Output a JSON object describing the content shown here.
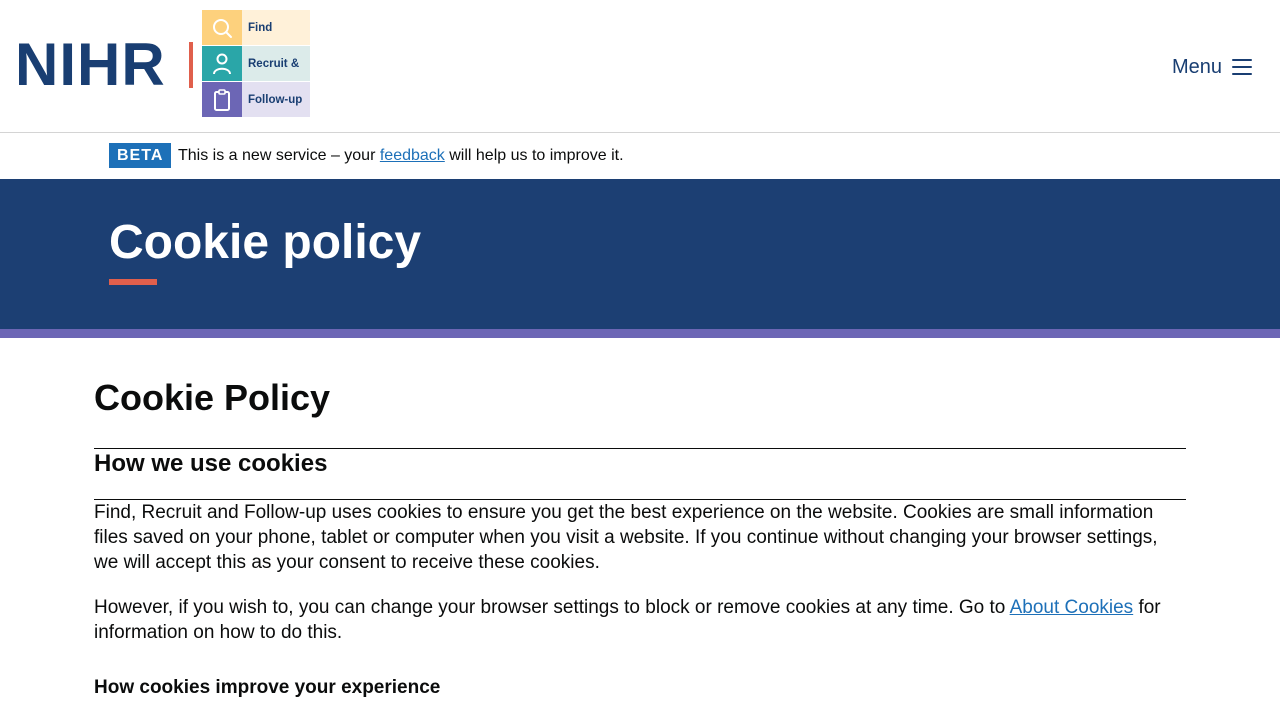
{
  "header": {
    "logo": {
      "org": "NIHR",
      "tiles": [
        "Find",
        "Recruit &",
        "Follow-up"
      ]
    },
    "menu_label": "Menu"
  },
  "beta_banner": {
    "tag": "BETA",
    "text_before": "This is a new service – your ",
    "link_text": "feedback",
    "text_after": " will help us to improve it."
  },
  "hero": {
    "title": "Cookie policy"
  },
  "main": {
    "heading": "Cookie Policy",
    "section_heading": "How we use cookies",
    "paragraph_1": "Find, Recruit and Follow-up uses cookies to ensure you get the best experience on the website. Cookies are small information files saved on your phone, tablet or computer when you visit a website.  If you continue without changing your browser settings, we will accept this as your consent to receive these cookies.",
    "paragraph_2_before": "However, if you wish to, you can change your browser settings to block or remove cookies at any time. Go to ",
    "paragraph_2_link": "About Cookies",
    "paragraph_2_after": " for information on how to do this.",
    "sub_heading": "How cookies improve your experience"
  },
  "colors": {
    "brand_navy": "#1c3f73",
    "accent_red": "#e05f4c",
    "accent_purple": "#6c66b5",
    "link_blue": "#1d70b8",
    "tile_yellow": "#fdd17d",
    "tile_teal": "#2aa6a8"
  },
  "icons": [
    "search-icon",
    "person-icon",
    "clipboard-icon",
    "hamburger-menu-icon"
  ]
}
